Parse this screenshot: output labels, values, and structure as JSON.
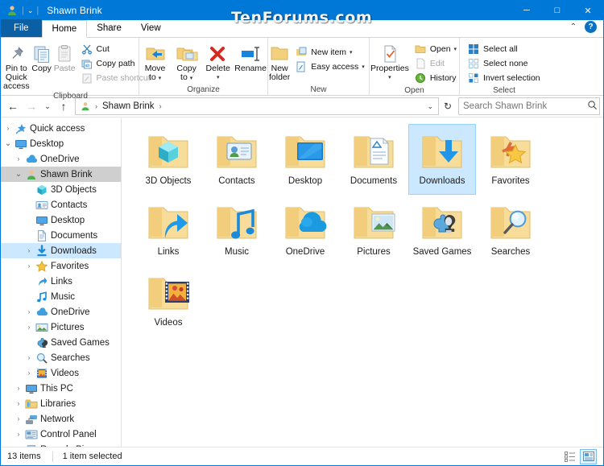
{
  "window": {
    "title": "Shawn Brink",
    "icon": "user-account-icon",
    "qat_chevron": "⌄",
    "minimize": "─",
    "maximize": "□",
    "close": "✕",
    "watermark": "TenForums.com"
  },
  "ribbon": {
    "tabs": [
      {
        "label": "File",
        "kind": "file"
      },
      {
        "label": "Home",
        "kind": "active"
      },
      {
        "label": "Share",
        "kind": "normal"
      },
      {
        "label": "View",
        "kind": "normal"
      }
    ],
    "collapse_chevron": "⌃",
    "help_label": "?",
    "groups": [
      {
        "name": "Clipboard",
        "big": [
          {
            "label": "Pin to Quick\naccess",
            "line1": "Pin to Quick",
            "line2": "access",
            "icon": "pin-icon",
            "disabled": false
          },
          {
            "label": "Copy",
            "line1": "Copy",
            "line2": "",
            "icon": "copy-icon",
            "disabled": false
          },
          {
            "label": "Paste",
            "line1": "Paste",
            "line2": "",
            "icon": "paste-icon",
            "disabled": true
          }
        ],
        "small": [
          {
            "label": "Cut",
            "icon": "scissors-icon",
            "disabled": false,
            "caret": false
          },
          {
            "label": "Copy path",
            "icon": "copy-path-icon",
            "disabled": false,
            "caret": false
          },
          {
            "label": "Paste shortcut",
            "icon": "paste-shortcut-icon",
            "disabled": true,
            "caret": false
          }
        ]
      },
      {
        "name": "Organize",
        "big": [
          {
            "line1": "Move",
            "line2": "to",
            "icon": "move-to-icon",
            "caret": true,
            "disabled": false
          },
          {
            "line1": "Copy",
            "line2": "to",
            "icon": "copy-to-icon",
            "caret": true,
            "disabled": false
          },
          {
            "line1": "Delete",
            "line2": "",
            "icon": "delete-icon",
            "caret": true,
            "disabled": false
          },
          {
            "line1": "Rename",
            "line2": "",
            "icon": "rename-icon",
            "caret": false,
            "disabled": false
          }
        ],
        "small": []
      },
      {
        "name": "New",
        "big": [
          {
            "line1": "New",
            "line2": "folder",
            "icon": "new-folder-icon",
            "caret": false,
            "disabled": false
          }
        ],
        "small": [
          {
            "label": "New item",
            "icon": "new-item-icon",
            "disabled": false,
            "caret": true
          },
          {
            "label": "Easy access",
            "icon": "easy-access-icon",
            "disabled": false,
            "caret": true
          }
        ]
      },
      {
        "name": "Open",
        "big": [
          {
            "line1": "Properties",
            "line2": "",
            "icon": "properties-icon",
            "caret": true,
            "disabled": false
          }
        ],
        "small": [
          {
            "label": "Open",
            "icon": "open-icon",
            "disabled": false,
            "caret": true
          },
          {
            "label": "Edit",
            "icon": "edit-icon",
            "disabled": true,
            "caret": false
          },
          {
            "label": "History",
            "icon": "history-icon",
            "disabled": false,
            "caret": false
          }
        ]
      },
      {
        "name": "Select",
        "big": [],
        "small": [
          {
            "label": "Select all",
            "icon": "select-all-icon",
            "disabled": false,
            "caret": false
          },
          {
            "label": "Select none",
            "icon": "select-none-icon",
            "disabled": false,
            "caret": false
          },
          {
            "label": "Invert selection",
            "icon": "invert-selection-icon",
            "disabled": false,
            "caret": false
          }
        ]
      }
    ]
  },
  "addressbar": {
    "back": "←",
    "forward": "→",
    "recent": "⌄",
    "up": "↑",
    "crumb_icon": "user-account-icon",
    "crumbs": [
      "Shawn Brink"
    ],
    "sep": "›",
    "dropdown": "⌄",
    "refresh": "↻",
    "search_placeholder": "Search Shawn Brink",
    "search_value": "",
    "search_icon": "search-icon"
  },
  "sidebar": {
    "items": [
      {
        "label": "Quick access",
        "icon": "pin-star-icon",
        "indent": 0,
        "expander": "collapsed",
        "state": "none"
      },
      {
        "label": "Desktop",
        "icon": "desktop-icon",
        "indent": 0,
        "expander": "expanded",
        "state": "none"
      },
      {
        "label": "OneDrive",
        "icon": "onedrive-icon",
        "indent": 1,
        "expander": "collapsed",
        "state": "none"
      },
      {
        "label": "Shawn Brink",
        "icon": "user-account-icon",
        "indent": 1,
        "expander": "expanded",
        "state": "gray"
      },
      {
        "label": "3D Objects",
        "icon": "3d-objects-icon",
        "indent": 2,
        "expander": "none",
        "state": "none"
      },
      {
        "label": "Contacts",
        "icon": "contacts-icon",
        "indent": 2,
        "expander": "none",
        "state": "none"
      },
      {
        "label": "Desktop",
        "icon": "desktop-icon",
        "indent": 2,
        "expander": "none",
        "state": "none"
      },
      {
        "label": "Documents",
        "icon": "documents-icon",
        "indent": 2,
        "expander": "none",
        "state": "none"
      },
      {
        "label": "Downloads",
        "icon": "downloads-icon",
        "indent": 2,
        "expander": "collapsed",
        "state": "blue"
      },
      {
        "label": "Favorites",
        "icon": "favorites-icon",
        "indent": 2,
        "expander": "collapsed",
        "state": "none"
      },
      {
        "label": "Links",
        "icon": "links-icon",
        "indent": 2,
        "expander": "none",
        "state": "none"
      },
      {
        "label": "Music",
        "icon": "music-icon",
        "indent": 2,
        "expander": "none",
        "state": "none"
      },
      {
        "label": "OneDrive",
        "icon": "onedrive-icon",
        "indent": 2,
        "expander": "collapsed",
        "state": "none"
      },
      {
        "label": "Pictures",
        "icon": "pictures-icon",
        "indent": 2,
        "expander": "collapsed",
        "state": "none"
      },
      {
        "label": "Saved Games",
        "icon": "saved-games-icon",
        "indent": 2,
        "expander": "none",
        "state": "none"
      },
      {
        "label": "Searches",
        "icon": "searches-icon",
        "indent": 2,
        "expander": "collapsed",
        "state": "none"
      },
      {
        "label": "Videos",
        "icon": "videos-icon",
        "indent": 2,
        "expander": "collapsed",
        "state": "none"
      },
      {
        "label": "This PC",
        "icon": "this-pc-icon",
        "indent": 1,
        "expander": "collapsed",
        "state": "none"
      },
      {
        "label": "Libraries",
        "icon": "libraries-icon",
        "indent": 1,
        "expander": "collapsed",
        "state": "none"
      },
      {
        "label": "Network",
        "icon": "network-icon",
        "indent": 1,
        "expander": "collapsed",
        "state": "none"
      },
      {
        "label": "Control Panel",
        "icon": "control-panel-icon",
        "indent": 1,
        "expander": "collapsed",
        "state": "none"
      },
      {
        "label": "Recycle Bin",
        "icon": "recycle-bin-icon",
        "indent": 1,
        "expander": "none",
        "state": "none"
      }
    ]
  },
  "content": {
    "items": [
      {
        "label": "3D Objects",
        "icon": "folder-3d-objects",
        "selected": false
      },
      {
        "label": "Contacts",
        "icon": "folder-contacts",
        "selected": false
      },
      {
        "label": "Desktop",
        "icon": "folder-desktop",
        "selected": false
      },
      {
        "label": "Documents",
        "icon": "folder-documents",
        "selected": false
      },
      {
        "label": "Downloads",
        "icon": "folder-downloads",
        "selected": true
      },
      {
        "label": "Favorites",
        "icon": "folder-favorites",
        "selected": false
      },
      {
        "label": "Links",
        "icon": "folder-links",
        "selected": false
      },
      {
        "label": "Music",
        "icon": "folder-music",
        "selected": false
      },
      {
        "label": "OneDrive",
        "icon": "folder-onedrive",
        "selected": false
      },
      {
        "label": "Pictures",
        "icon": "folder-pictures",
        "selected": false
      },
      {
        "label": "Saved Games",
        "icon": "folder-saved-games",
        "selected": false
      },
      {
        "label": "Searches",
        "icon": "folder-searches",
        "selected": false
      },
      {
        "label": "Videos",
        "icon": "folder-videos",
        "selected": false
      }
    ]
  },
  "statusbar": {
    "item_count": "13 items",
    "selection": "1 item selected",
    "details_view_icon": "details-view-icon",
    "large_icons_view_icon": "large-icons-view-icon",
    "active_view": "large-icons-view-icon"
  },
  "colors": {
    "accent": "#0078d7",
    "selection_fill": "#cce8ff",
    "selection_border": "#99d1ff",
    "tree_selected_gray": "#cfcfcf",
    "folder_yellow": "#f5d07f"
  }
}
